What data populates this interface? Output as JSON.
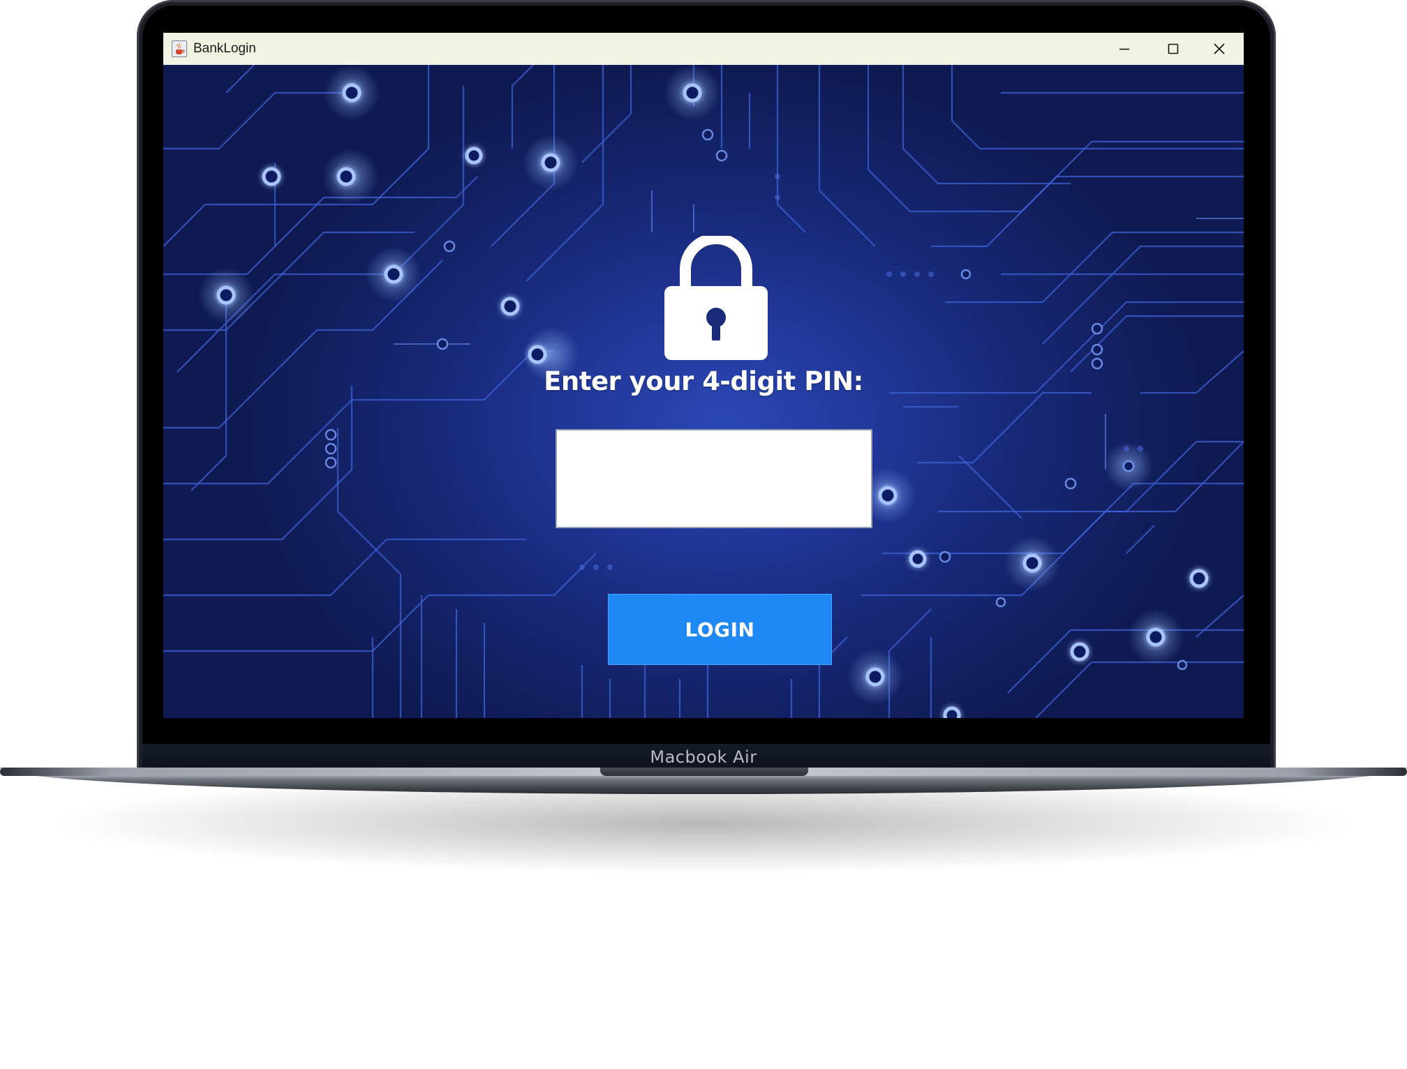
{
  "device": {
    "label": "Macbook Air"
  },
  "window": {
    "title": "BankLogin",
    "app_icon": "java-cup-icon",
    "controls": {
      "minimize_icon": "minimize-icon",
      "maximize_icon": "maximize-icon",
      "close_icon": "close-icon"
    }
  },
  "login": {
    "lock_icon": "padlock-icon",
    "prompt": "Enter your 4-digit PIN:",
    "pin_value": "",
    "pin_placeholder": "",
    "button_label": "LOGIN"
  },
  "colors": {
    "titlebar": "#f1f4e2",
    "background": "#1b2f86",
    "circuit_glow": "#8fb4ff",
    "button": "#1e88f5",
    "text": "#ffffff"
  }
}
